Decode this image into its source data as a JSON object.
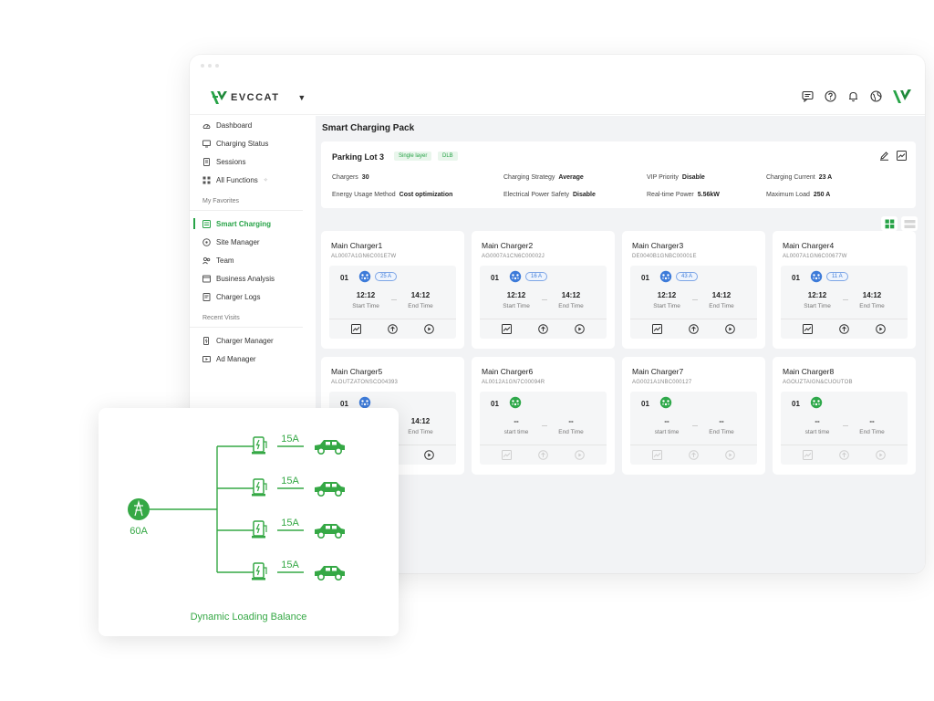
{
  "brand": {
    "name": "EVCCAT"
  },
  "colors": {
    "accent": "#27a347",
    "blue": "#3d7bd9"
  },
  "topbar_icons": [
    "message-icon",
    "help-icon",
    "bell-icon",
    "globe-icon",
    "logo-icon"
  ],
  "sidebar": {
    "items": [
      {
        "label": "Dashboard",
        "icon": "dashboard-icon"
      },
      {
        "label": "Charging Status",
        "icon": "monitor-icon"
      },
      {
        "label": "Sessions",
        "icon": "document-icon"
      },
      {
        "label": "All Functions",
        "icon": "grid-icon"
      }
    ],
    "favorites_title": "My Favorites",
    "favorites": [
      {
        "label": "Smart Charging",
        "icon": "smart-charging-icon",
        "active": true
      },
      {
        "label": "Site Manager",
        "icon": "site-icon"
      },
      {
        "label": "Team",
        "icon": "team-icon"
      },
      {
        "label": "Business Analysis",
        "icon": "analysis-icon"
      },
      {
        "label": "Charger Logs",
        "icon": "logs-icon"
      }
    ],
    "recent_title": "Recent Visits",
    "recent": [
      {
        "label": "Charger Manager",
        "icon": "charger-icon"
      },
      {
        "label": "Ad Manager",
        "icon": "ad-icon"
      }
    ]
  },
  "page": {
    "title": "Smart Charging Pack",
    "lot": {
      "name": "Parking Lot 3",
      "tags": [
        "Single layer",
        "DLB"
      ],
      "fields": [
        {
          "label": "Chargers",
          "value": "30"
        },
        {
          "label": "Charging Strategy",
          "value": "Average"
        },
        {
          "label": "VIP Priority",
          "value": "Disable"
        },
        {
          "label": "Charging Current",
          "value": "23 A"
        },
        {
          "label": "Energy Usage Method",
          "value": "Cost optimization"
        },
        {
          "label": "Electrical Power Safety",
          "value": "Disable"
        },
        {
          "label": "Real-time Power",
          "value": "5.56kW"
        },
        {
          "label": "Maximum Load",
          "value": "250 A"
        }
      ]
    }
  },
  "chargers": [
    {
      "name": "Main Charger1",
      "sn": "AL0007A1GN6C001E7W",
      "connector": "01",
      "amps": "25 A",
      "start": "12:12",
      "end": "14:12",
      "start_label": "Start Time",
      "end_label": "End Time",
      "status": "charging"
    },
    {
      "name": "Main Charger2",
      "sn": "AG0007A1CN6C00002J",
      "connector": "01",
      "amps": "16 A",
      "start": "12:12",
      "end": "14:12",
      "start_label": "Start Time",
      "end_label": "End Time",
      "status": "charging"
    },
    {
      "name": "Main Charger3",
      "sn": "DE0040B1GNBC00001E",
      "connector": "01",
      "amps": "43 A",
      "start": "12:12",
      "end": "14:12",
      "start_label": "Start Time",
      "end_label": "End Time",
      "status": "charging"
    },
    {
      "name": "Main Charger4",
      "sn": "AL0007A1GN6C00677W",
      "connector": "01",
      "amps": "11 A",
      "start": "12:12",
      "end": "14:12",
      "start_label": "Start Time",
      "end_label": "End Time",
      "status": "charging"
    },
    {
      "name": "Main Charger5",
      "sn": "ALOUTZATONSCO04393",
      "connector": "01",
      "amps": "",
      "start": "",
      "end": "14:12",
      "start_label": "",
      "end_label": "End Time",
      "status": "charging"
    },
    {
      "name": "Main Charger6",
      "sn": "AL0012A1GN7C00094R",
      "connector": "01",
      "amps": "",
      "start": "--",
      "end": "--",
      "start_label": "start time",
      "end_label": "End Time",
      "status": "idle"
    },
    {
      "name": "Main Charger7",
      "sn": "AG0021A1NBC000127",
      "connector": "01",
      "amps": "",
      "start": "--",
      "end": "--",
      "start_label": "start time",
      "end_label": "End Time",
      "status": "idle"
    },
    {
      "name": "Main Charger8",
      "sn": "AGOUZTAIGN&CUOUTOB",
      "connector": "01",
      "amps": "",
      "start": "--",
      "end": "--",
      "start_label": "start time",
      "end_label": "End Time",
      "status": "idle"
    }
  ],
  "dlb": {
    "title": "Dynamic Loading Balance",
    "source_amps": "60A",
    "branches": [
      "15A",
      "15A",
      "15A",
      "15A"
    ]
  }
}
